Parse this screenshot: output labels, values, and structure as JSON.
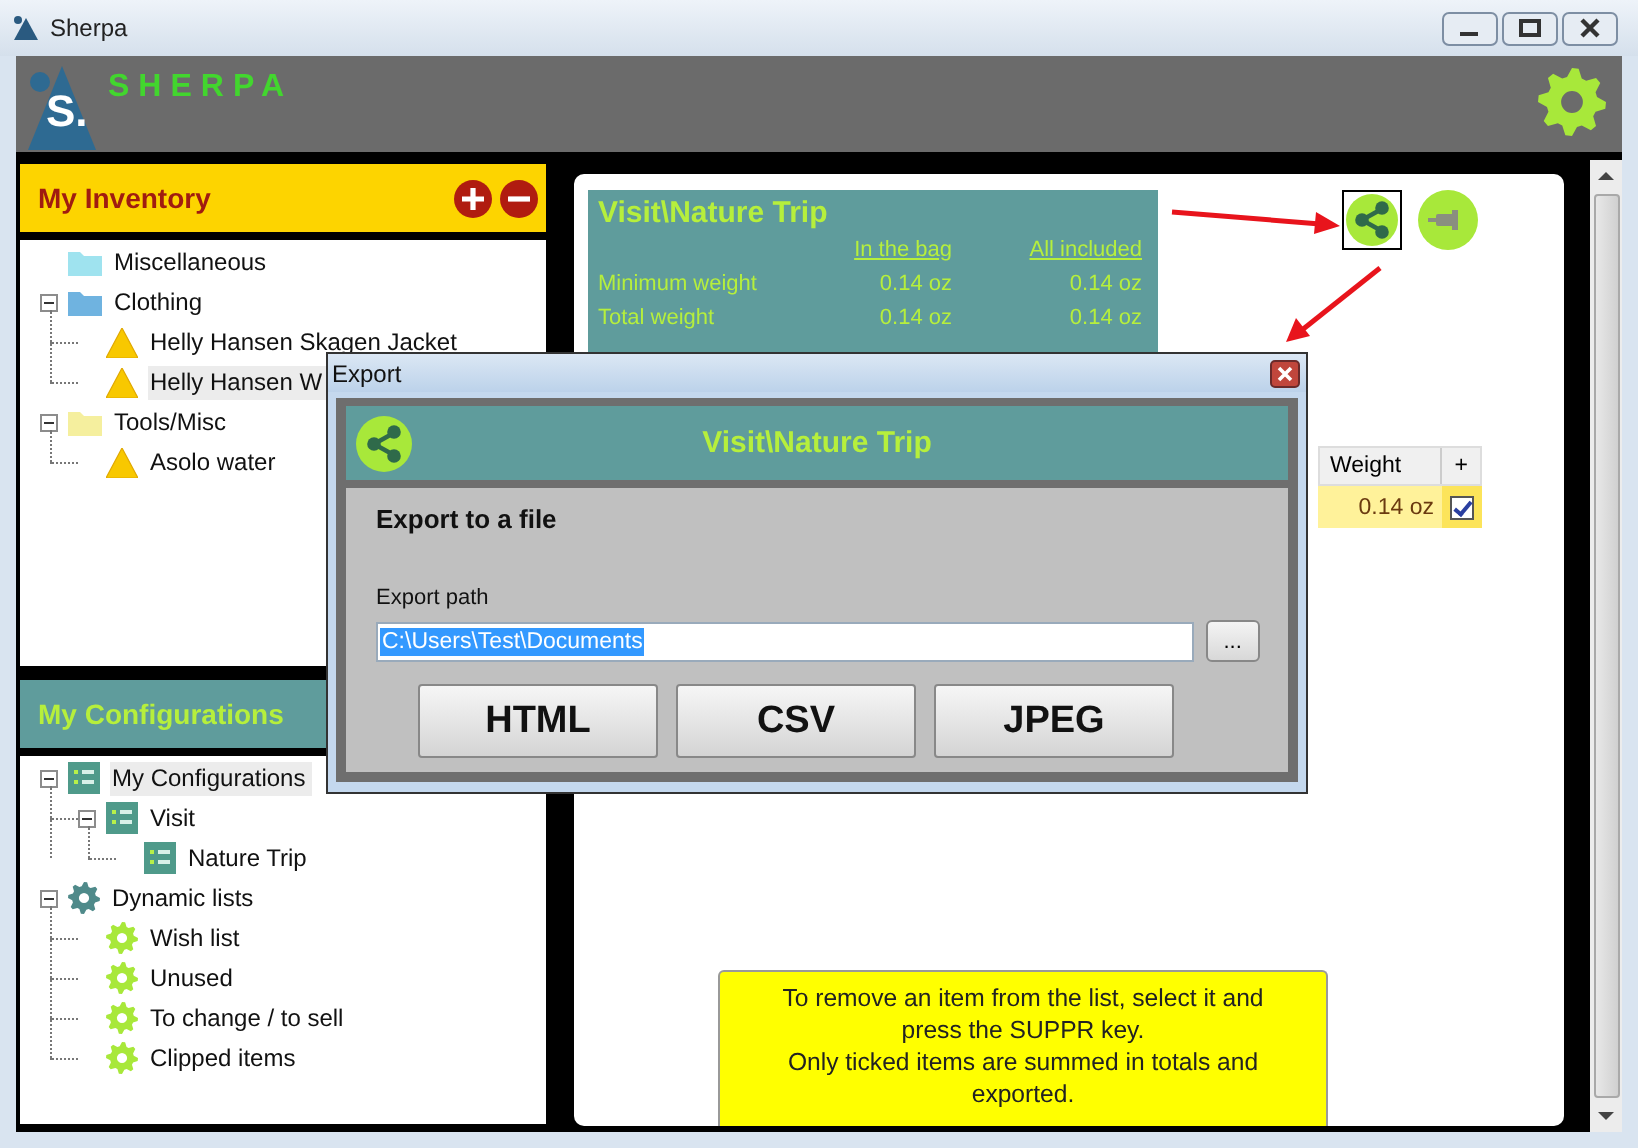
{
  "window": {
    "title": "Sherpa"
  },
  "header": {
    "logo_letter": "S.",
    "app_name": "SHERPA"
  },
  "inventory": {
    "title": "My Inventory",
    "tree": [
      {
        "label": "Miscellaneous",
        "kind": "folder",
        "color": "#9fe3ef",
        "selected": false
      },
      {
        "label": "Clothing",
        "kind": "folder",
        "color": "#6fb3e0",
        "selected": false,
        "expanded": true,
        "children": [
          {
            "label": "Helly Hansen Skagen Jacket",
            "kind": "item",
            "selected": false
          },
          {
            "label": "Helly Hansen W",
            "kind": "item",
            "selected": true
          }
        ]
      },
      {
        "label": "Tools/Misc",
        "kind": "folder",
        "color": "#f5ef9e",
        "selected": false,
        "expanded": true,
        "children": [
          {
            "label": "Asolo water",
            "kind": "item",
            "selected": false
          }
        ]
      }
    ]
  },
  "configurations": {
    "title": "My Configurations",
    "tree": [
      {
        "label": "My Configurations",
        "kind": "config",
        "selected": true,
        "expanded": true,
        "children": [
          {
            "label": "Visit",
            "kind": "config",
            "selected": false,
            "expanded": true,
            "children": [
              {
                "label": "Nature Trip",
                "kind": "config",
                "selected": false
              }
            ]
          }
        ]
      },
      {
        "label": "Dynamic lists",
        "kind": "dynamic",
        "selected": false,
        "expanded": true,
        "children": [
          {
            "label": "Wish list",
            "kind": "filter",
            "selected": false
          },
          {
            "label": "Unused",
            "kind": "filter",
            "selected": false
          },
          {
            "label": "To change / to sell",
            "kind": "filter",
            "selected": false
          },
          {
            "label": "Clipped items",
            "kind": "filter",
            "selected": false
          }
        ]
      }
    ]
  },
  "summary": {
    "title": "Visit\\Nature Trip",
    "columns": [
      "In the bag",
      "All included"
    ],
    "rows": [
      {
        "label": "Minimum weight",
        "values": [
          "0.14 oz",
          "0.14 oz"
        ]
      },
      {
        "label": "Total weight",
        "values": [
          "0.14 oz",
          "0.14 oz"
        ]
      }
    ]
  },
  "tools": [
    {
      "kind": "share",
      "selected": true
    },
    {
      "kind": "pin",
      "selected": false
    }
  ],
  "table": {
    "columns": [
      "Weight",
      "+"
    ],
    "rows": [
      {
        "weight": "0.14 oz",
        "checked": true
      }
    ]
  },
  "note": [
    "To remove an item from the list, select it and press the SUPPR key.",
    "Only ticked items are summed in totals and exported."
  ],
  "dialog": {
    "title": "Export",
    "header": "Visit\\Nature Trip",
    "section": "Export to a file",
    "path_label": "Export path",
    "path_value": "C:\\Users\\Test\\Documents",
    "browse": "...",
    "buttons": [
      "HTML",
      "CSV",
      "JPEG"
    ]
  }
}
